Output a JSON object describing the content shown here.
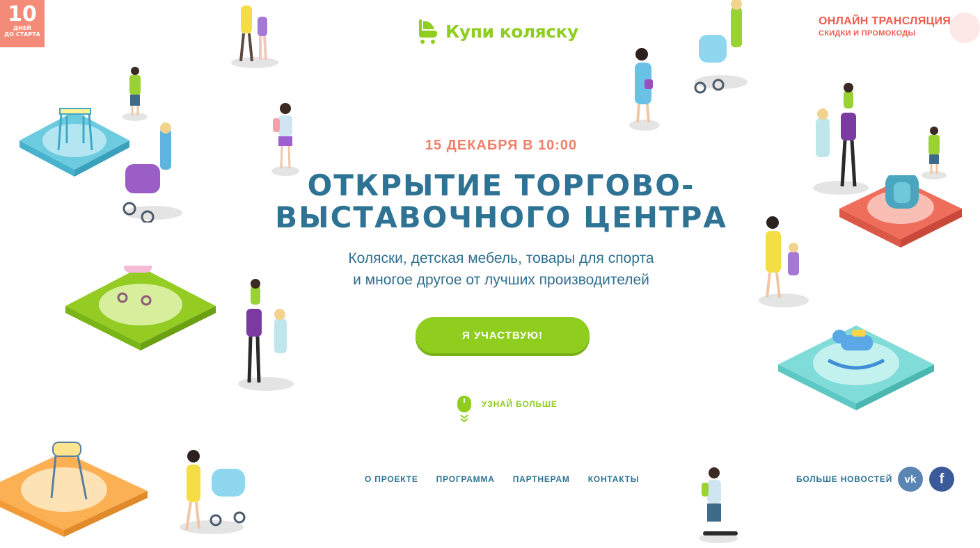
{
  "countdown": {
    "number": "10",
    "line1": "ДНЕЙ",
    "line2": "ДО СТАРТА"
  },
  "logo": {
    "text": "Купи коляску"
  },
  "live": {
    "title": "ОНЛАЙН ТРАНСЛЯЦИЯ",
    "subtitle": "СКИДКИ И ПРОМОКОДЫ"
  },
  "hero": {
    "date": "15 ДЕКАБРЯ В 10:00",
    "title_line1": "ОТКРЫТИЕ ТОРГОВО-",
    "title_line2": "ВЫСТАВОЧНОГО ЦЕНТРА",
    "subtitle_line1": "Коляски, детская мебель, товары для спорта",
    "subtitle_line2": "и многое другое от лучших производителей",
    "cta_label": "Я УЧАСТВУЮ!",
    "learn_more": "УЗНАЙ БОЛЬШЕ"
  },
  "nav": {
    "items": [
      {
        "label": "О ПРОЕКТЕ"
      },
      {
        "label": "ПРОГРАММА"
      },
      {
        "label": "ПАРТНЕРАМ"
      },
      {
        "label": "КОНТАКТЫ"
      }
    ]
  },
  "news": {
    "label": "БОЛЬШЕ НОВОСТЕЙ"
  },
  "social": {
    "vk": "vk",
    "fb": "f"
  },
  "colors": {
    "brand_green": "#8fcd1f",
    "title_blue": "#2e7394",
    "accent_coral": "#ef5b4d",
    "date_coral": "#f0806a",
    "vk_blue": "#5a84b2",
    "fb_blue": "#3b5a9a"
  }
}
